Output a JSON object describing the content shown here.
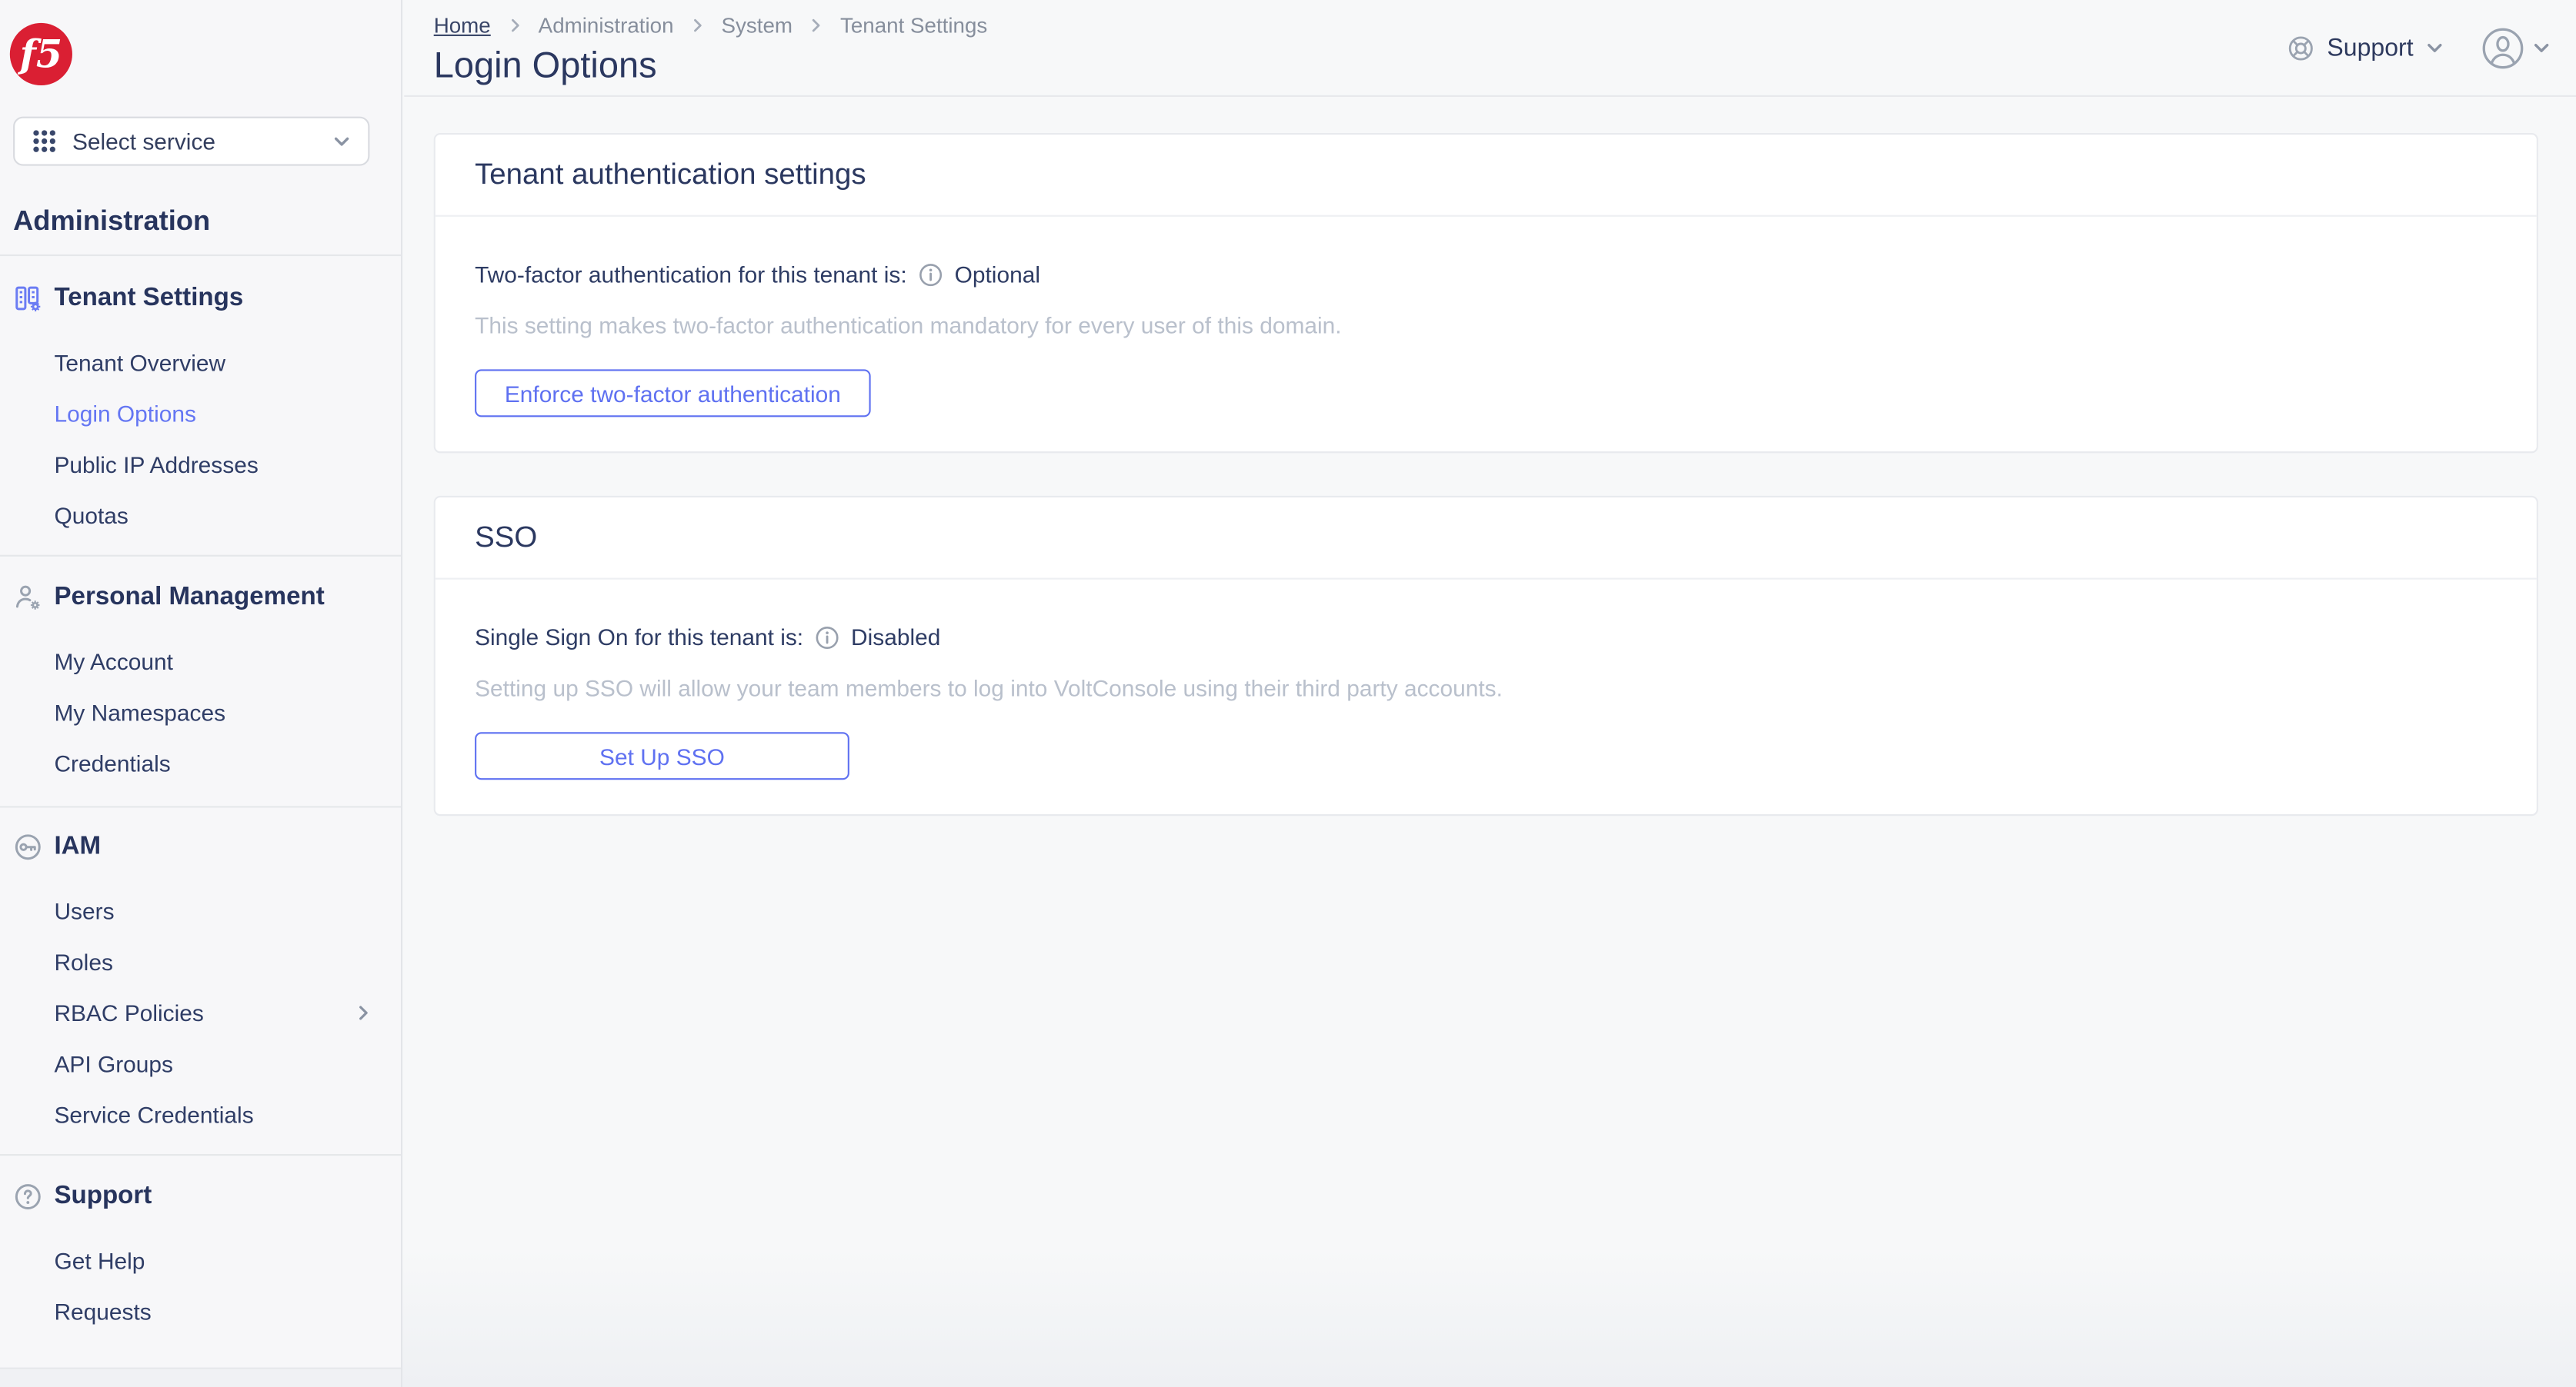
{
  "brand": {
    "logo_text": "f5"
  },
  "service_selector": {
    "label": "Select service"
  },
  "sidebar": {
    "title": "Administration",
    "sections": [
      {
        "label": "Tenant Settings",
        "icon": "building-gear-icon",
        "items": [
          {
            "label": "Tenant Overview"
          },
          {
            "label": "Login Options",
            "active": true
          },
          {
            "label": "Public IP Addresses"
          },
          {
            "label": "Quotas"
          }
        ]
      },
      {
        "label": "Personal Management",
        "icon": "user-gear-icon",
        "items": [
          {
            "label": "My Account"
          },
          {
            "label": "My Namespaces"
          },
          {
            "label": "Credentials"
          }
        ]
      },
      {
        "label": "IAM",
        "icon": "key-icon",
        "items": [
          {
            "label": "Users"
          },
          {
            "label": "Roles"
          },
          {
            "label": "RBAC Policies",
            "has_submenu": true
          },
          {
            "label": "API Groups"
          },
          {
            "label": "Service Credentials"
          }
        ]
      },
      {
        "label": "Support",
        "icon": "help-circle-icon",
        "items": [
          {
            "label": "Get Help"
          },
          {
            "label": "Requests"
          }
        ]
      }
    ]
  },
  "header": {
    "breadcrumb": [
      {
        "label": "Home"
      },
      {
        "label": "Administration"
      },
      {
        "label": "System"
      },
      {
        "label": "Tenant Settings"
      }
    ],
    "page_title": "Login Options",
    "support_menu_label": "Support"
  },
  "main": {
    "cards": [
      {
        "title": "Tenant authentication settings",
        "status_label": "Two-factor authentication for this tenant is:",
        "status_value": "Optional",
        "description": "This setting makes two-factor authentication mandatory for every user of this domain.",
        "button_label": "Enforce two-factor authentication"
      },
      {
        "title": "SSO",
        "status_label": "Single Sign On for this tenant is:",
        "status_value": "Disabled",
        "description": "Setting up SSO will allow your team members to log into VoltConsole using their third party accounts.",
        "button_label": "Set Up SSO"
      }
    ]
  },
  "icons": {
    "apps_grid": "apps-grid-icon",
    "chevron_down": "chevron-down-icon",
    "chevron_right": "chevron-right-icon",
    "info": "info-icon",
    "lifebuoy": "lifebuoy-icon",
    "avatar": "avatar-icon"
  },
  "colors": {
    "accent_blue": "#5f71f1",
    "active_link_blue": "#6476f3",
    "brand_red": "#da1f33",
    "navy_text": "#2c3a64",
    "muted_gray": "#868e9c",
    "faint_gray": "#b9c0cc",
    "page_bg": "#f7f8f9",
    "card_border": "#e8eaee"
  }
}
